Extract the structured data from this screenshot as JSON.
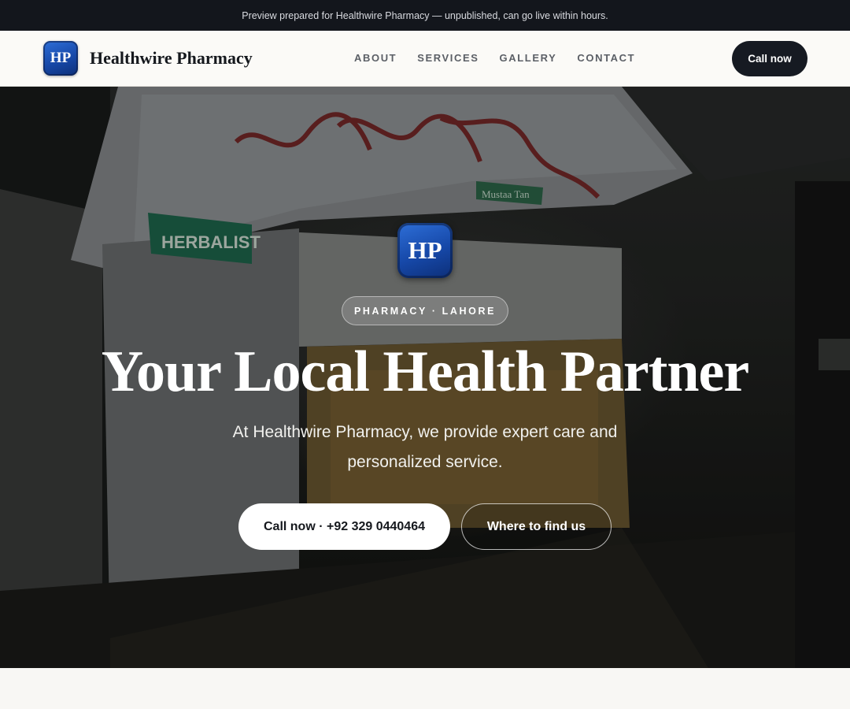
{
  "banner": {
    "text": "Preview prepared for Healthwire Pharmacy — unpublished, can go live within hours."
  },
  "header": {
    "logo_initials": "HP",
    "brand_name": "Healthwire Pharmacy",
    "nav": [
      "ABOUT",
      "SERVICES",
      "GALLERY",
      "CONTACT"
    ],
    "call_label": "Call now"
  },
  "hero": {
    "logo_initials": "HP",
    "tag": "PHARMACY · LAHORE",
    "title": "Your Local Health Partner",
    "subtitle": "At Healthwire Pharmacy, we provide expert care and personalized service.",
    "primary_button": "Call now · +92 329 0440464",
    "secondary_button": "Where to find us",
    "photo_signs": [
      "HERBALIST",
      "Mustaa Tan"
    ]
  },
  "colors": {
    "banner_bg": "#13161c",
    "header_bg": "#fbfaf7",
    "dark_button": "#161a22",
    "logo_blue": "#1648a8",
    "herbalist_sign": "#1f6b4f"
  }
}
